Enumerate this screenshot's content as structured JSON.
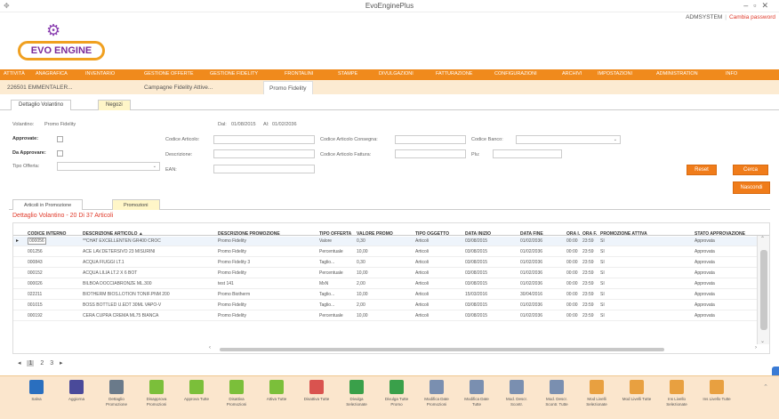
{
  "window": {
    "title": "EvoEnginePlus"
  },
  "header": {
    "logo_text": "EVO ENGINE",
    "user": "ADMSYSTEM",
    "change_password": "Cambia password"
  },
  "menu": [
    "ATTIVITÀ",
    "ANAGRAFICA",
    "INVENTARIO",
    "GESTIONE OFFERTE",
    "GESTIONE FIDELITY",
    "FRONTALINI",
    "STAMPE",
    "DIVULGAZIONI",
    "FATTURAZIONE",
    "CONFIGURAZIONI",
    "ARCHIVI",
    "IMPOSTAZIONI",
    "ADMINISTRATION",
    "INFO"
  ],
  "doc_tabs": [
    "226501 EMMENTALER...",
    "Campagne Fidelity Attive...",
    "Promo Fidelity"
  ],
  "sub_tabs": [
    "Dettaglio Volantino",
    "Negozi"
  ],
  "form": {
    "volantino_label": "Volantino:",
    "volantino_value": "Promo Fidelity",
    "dal_label": "Dal:",
    "dal_value": "01/08/2015",
    "al_label": "Al:",
    "al_value": "01/02/2036",
    "approvate_label": "Approvate:",
    "da_approvare_label": "Da Approvare:",
    "tipo_offerta_label": "Tipo Offerta:",
    "codice_articolo_label": "Codice Articolo:",
    "descrizione_label": "Descrizione:",
    "ean_label": "EAN:",
    "codice_consegna_label": "Codice Articolo Consegna:",
    "codice_fattura_label": "Codice Articolo Fattura:",
    "codice_banco_label": "Codice Banco:",
    "plu_label": "Plu:"
  },
  "buttons": {
    "reset": "Reset",
    "cerca": "Cerca",
    "nascondi": "Nascondi"
  },
  "panel_tabs": [
    "Articoli in Promozione",
    "Promozioni"
  ],
  "grid": {
    "title": "Dettaglio Volantino - 20 Di 37 Articoli",
    "headers": [
      "CODICE INTERNO",
      "DESCRIZIONE ARTICOLO ▲",
      "DESCRIZIONE PROMOZIONE",
      "TIPO OFFERTA",
      "VALORE PROMO",
      "TIPO OGGETTO",
      "DATA INIZIO",
      "DATA FINE",
      "ORA I.",
      "ORA F.",
      "PROMOZIONE ATTIVA",
      "STATO APPROVAZIONE"
    ],
    "rows": [
      [
        "000056",
        "**CHAT EXCELLENTEN GR400 CROC",
        "Promo Fidelity",
        "Valore",
        "0,30",
        "Articoli",
        "03/08/2015",
        "01/02/2036",
        "00:00",
        "23:59",
        "SI",
        "Approvata"
      ],
      [
        "001256",
        "ACE LAV.DETERSIVO 23 MISURINI",
        "Promo Fidelity",
        "Percentuale",
        "10,00",
        "Articoli",
        "03/08/2015",
        "01/02/2036",
        "00:00",
        "23:59",
        "SI",
        "Approvata"
      ],
      [
        "000843",
        "ACQUA FIUGGI LT.1",
        "Promo Fidelity 3",
        "Taglio...",
        "0,30",
        "Articoli",
        "03/08/2015",
        "01/02/2036",
        "00:00",
        "23:59",
        "SI",
        "Approvata"
      ],
      [
        "000152",
        "ACQUA LILIA LT.2 X 6 BOT",
        "Promo Fidelity",
        "Percentuale",
        "10,00",
        "Articoli",
        "03/08/2015",
        "01/02/2036",
        "00:00",
        "23:59",
        "SI",
        "Approvata"
      ],
      [
        "000026",
        "BILBOA DOCCIABRONZE ML.300",
        "test 141",
        "MxN",
        "2,00",
        "Articoli",
        "03/08/2015",
        "01/02/2036",
        "00:00",
        "23:59",
        "SI",
        "Approvata"
      ],
      [
        "022211",
        "BIOTHERM BIOS.LOTION TONIF.PNM 200",
        "Promo Biotherm",
        "Taglio...",
        "10,00",
        "Articoli",
        "15/03/2016",
        "30/04/2016",
        "00:00",
        "23:59",
        "SI",
        "Approvata"
      ],
      [
        "001015",
        "BOSS BOTTLED U.EDT 30ML VAPO-V",
        "Promo Fidelity",
        "Taglio...",
        "2,00",
        "Articoli",
        "03/08/2015",
        "01/02/2036",
        "00:00",
        "23:59",
        "SI",
        "Approvata"
      ],
      [
        "000192",
        "CERA CUPRA CREMA ML75 BIANCA",
        "Promo Fidelity",
        "Percentuale",
        "10,00",
        "Articoli",
        "03/08/2015",
        "01/02/2036",
        "00:00",
        "23:59",
        "SI",
        "Approvata"
      ]
    ]
  },
  "pager": {
    "prev": "◂",
    "pages": [
      "1",
      "2",
      "3"
    ],
    "current": "1",
    "next": "▸"
  },
  "toolbar": [
    {
      "label": "Salva",
      "color": "#2a6fbf"
    },
    {
      "label": "Aggiorna",
      "color": "#4a4a9a"
    },
    {
      "label": "Dettaglio Promozione",
      "color": "#6a7a8a"
    },
    {
      "label": "Disapprova Promozioni",
      "color": "#7bbf3a"
    },
    {
      "label": "Approva Tutte",
      "color": "#7bbf3a"
    },
    {
      "label": "Disattiva Promozioni",
      "color": "#7bbf3a"
    },
    {
      "label": "Attiva Tutte",
      "color": "#7bbf3a"
    },
    {
      "label": "Disattiva Tutte",
      "color": "#d9534f"
    },
    {
      "label": "Divulga Selezionate",
      "color": "#3aa04a"
    },
    {
      "label": "Divulga Tutte Promo",
      "color": "#3aa04a"
    },
    {
      "label": "Modifica Date Promozioni",
      "color": "#7a8fb0"
    },
    {
      "label": "Modifica Date Tutte",
      "color": "#7a8fb0"
    },
    {
      "label": "Mod. Descr. Scontr.",
      "color": "#7a8fb0"
    },
    {
      "label": "Mod. Descr. Scontr. Tutte",
      "color": "#7a8fb0"
    },
    {
      "label": "Mod Livelli Selezionate",
      "color": "#e8a040"
    },
    {
      "label": "Mod Livelli Tutte",
      "color": "#e8a040"
    },
    {
      "label": "Ins Livello Selezionate",
      "color": "#e8a040"
    },
    {
      "label": "Ins Livello Tutte",
      "color": "#e8a040"
    }
  ]
}
